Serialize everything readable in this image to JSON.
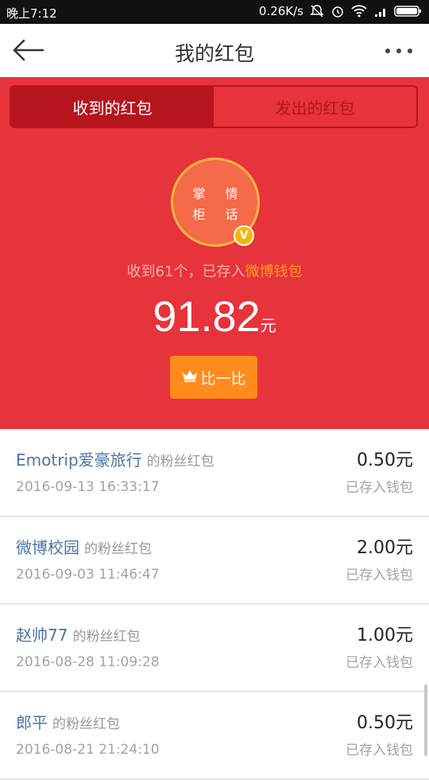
{
  "status_bar": {
    "time": "晚上7:12",
    "speed": "0.26K/s"
  },
  "nav": {
    "title": "我的红包"
  },
  "tabs": [
    {
      "label": "收到的红包",
      "active": true
    },
    {
      "label": "发出的红包",
      "active": false
    }
  ],
  "summary": {
    "avatar_text_line1": "掌 情",
    "avatar_text_line2": "柜 话",
    "badge": "V",
    "received_prefix": "收到61个，已存入",
    "wallet_link": "微博钱包",
    "amount": "91.82",
    "unit": "元",
    "compare_label": "比一比"
  },
  "records": [
    {
      "sender": "Emotrip爱豪旅行",
      "suffix": "的粉丝红包",
      "date": "2016-09-13 16:33:17",
      "amount": "0.50元",
      "status": "已存入钱包"
    },
    {
      "sender": "微博校园",
      "suffix": "的粉丝红包",
      "date": "2016-09-03 11:46:47",
      "amount": "2.00元",
      "status": "已存入钱包"
    },
    {
      "sender": "赵帅77",
      "suffix": "的粉丝红包",
      "date": "2016-08-28 11:09:28",
      "amount": "1.00元",
      "status": "已存入钱包"
    },
    {
      "sender": "郎平",
      "suffix": "的粉丝红包",
      "date": "2016-08-21 21:24:10",
      "amount": "0.50元",
      "status": "已存入钱包"
    }
  ],
  "colors": {
    "hero": "#e7333b",
    "tab_active": "#b7151e",
    "accent_orange": "#ff8b1c",
    "link_blue": "#4a75a4"
  }
}
